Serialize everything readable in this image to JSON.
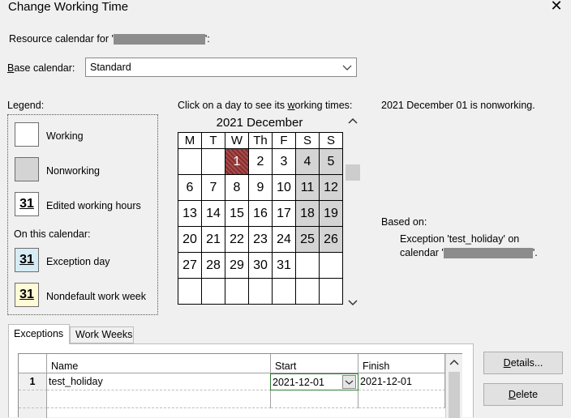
{
  "window": {
    "title": "Change Working Time",
    "close_glyph": "✕"
  },
  "resource": {
    "label_prefix": "Resource calendar for '",
    "label_suffix": "':"
  },
  "base_calendar": {
    "label_ul": "B",
    "label_rest": "ase calendar:",
    "value": "Standard"
  },
  "legend": {
    "title": "Legend:",
    "working": "Working",
    "nonworking": "Nonworking",
    "edited": "Edited working hours",
    "edited_num": "31",
    "on_this_calendar": "On this calendar:",
    "exception": "Exception day",
    "exception_num": "31",
    "nondefault": "Nondefault work week",
    "nondefault_num": "31"
  },
  "instruction": {
    "pre": "Click on a day to see its ",
    "ul": "w",
    "post": "orking times:"
  },
  "calendar": {
    "month_label": "2021 December",
    "days_header": [
      "M",
      "T",
      "W",
      "Th",
      "F",
      "S",
      "S"
    ],
    "weeks": [
      [
        "",
        "",
        "1",
        "2",
        "3",
        "4",
        "5"
      ],
      [
        "6",
        "7",
        "8",
        "9",
        "10",
        "11",
        "12"
      ],
      [
        "13",
        "14",
        "15",
        "16",
        "17",
        "18",
        "19"
      ],
      [
        "20",
        "21",
        "22",
        "23",
        "24",
        "25",
        "26"
      ],
      [
        "27",
        "28",
        "29",
        "30",
        "31",
        "",
        ""
      ],
      [
        "",
        "",
        "",
        "",
        "",
        "",
        ""
      ]
    ]
  },
  "info": {
    "status": "2021 December 01 is nonworking.",
    "based_on": "Based on:",
    "exception_line": "Exception 'test_holiday' on",
    "calendar_prefix": "calendar '",
    "calendar_suffix": "'."
  },
  "tabs": [
    {
      "label": "Exceptions"
    },
    {
      "label": "Work Weeks"
    }
  ],
  "exceptions_table": {
    "columns": [
      "Name",
      "Start",
      "Finish"
    ],
    "rows": [
      {
        "num": "1",
        "name": "test_holiday",
        "start": "2021-12-01",
        "finish": "2021-12-01"
      }
    ]
  },
  "buttons": {
    "details_ul": "D",
    "details_rest": "etails...",
    "delete_ul": "D",
    "delete_rest": "elete"
  },
  "colors": {
    "exception": "#8b2a2a",
    "nonworking": "#d4d4d4",
    "exception_legend": "#d6ecf5",
    "nondefault_legend": "#fffbd6"
  }
}
